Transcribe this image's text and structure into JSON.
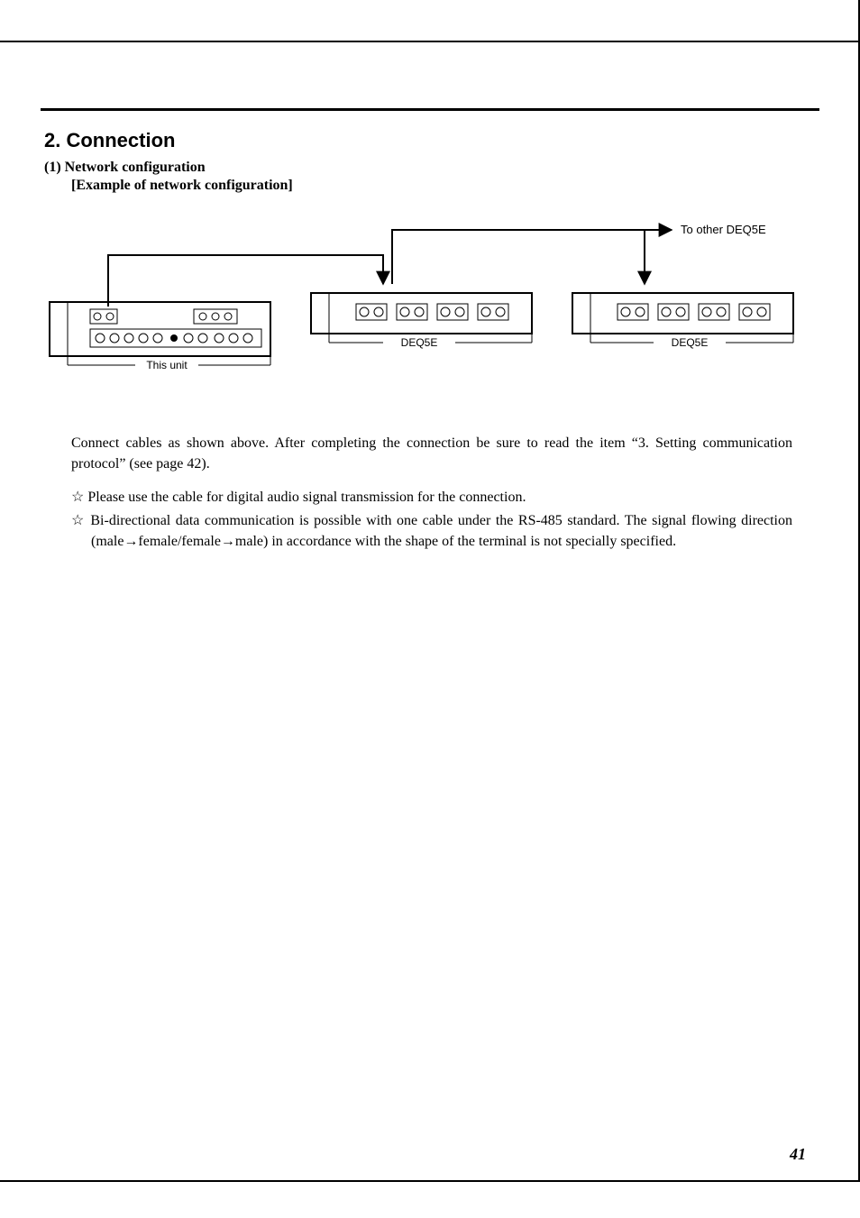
{
  "section_title": "2.  Connection",
  "sub1": "(1)  Network configuration",
  "sub2": "[Example of network configuration]",
  "diagram": {
    "to_other": "To other DEQ5E",
    "deq5e": "DEQ5E",
    "this_unit": "This unit"
  },
  "para1": "Connect cables as shown above. After completing the connection be sure to read the item “3. Setting communication protocol” (see page 42).",
  "bullets": [
    "Please use the cable for digital audio signal transmission for the connection.",
    "Bi-directional data communication is possible with one cable under the RS-485 standard. The signal flowing direction (male→female/female→male) in accordance with the shape of the terminal is not specially specified."
  ],
  "page_number": "41"
}
